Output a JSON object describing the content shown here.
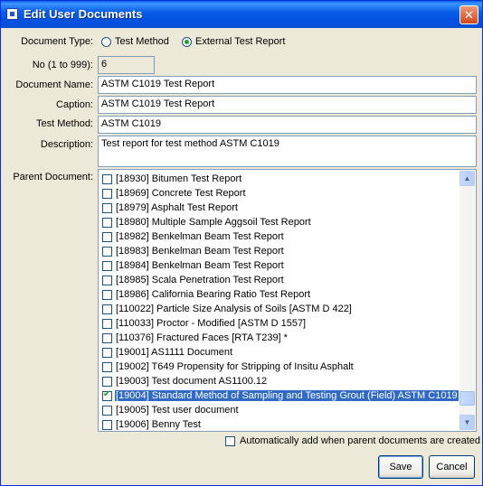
{
  "window": {
    "title": "Edit User Documents"
  },
  "document_type": {
    "label": "Document Type:",
    "options": [
      "Test Method",
      "External Test Report"
    ],
    "selected": "External Test Report"
  },
  "number": {
    "label": "No (1 to 999):",
    "value": "6"
  },
  "document_name": {
    "label": "Document Name:",
    "value": "ASTM C1019 Test Report"
  },
  "caption": {
    "label": "Caption:",
    "value": "ASTM C1019 Test Report"
  },
  "test_method": {
    "label": "Test Method:",
    "value": "ASTM C1019"
  },
  "description": {
    "label": "Description:",
    "value": "Test report for test method ASTM C1019"
  },
  "parent_document": {
    "label": "Parent Document:",
    "items": [
      {
        "text": "[18930] Bitumen Test Report",
        "checked": false
      },
      {
        "text": "[18969] Concrete Test Report",
        "checked": false
      },
      {
        "text": "[18979] Asphalt Test Report",
        "checked": false
      },
      {
        "text": "[18980] Multiple Sample Aggsoil Test Report",
        "checked": false
      },
      {
        "text": "[18982] Benkelman Beam Test Report",
        "checked": false
      },
      {
        "text": "[18983] Benkelman Beam Test Report",
        "checked": false
      },
      {
        "text": "[18984] Benkelman Beam Test Report",
        "checked": false
      },
      {
        "text": "[18985] Scala Penetration Test Report",
        "checked": false
      },
      {
        "text": "[18986] California Bearing Ratio Test Report",
        "checked": false
      },
      {
        "text": "[110022] Particle Size Analysis of Soils [ASTM D 422]",
        "checked": false
      },
      {
        "text": "[110033] Proctor - Modified [ASTM D 1557]",
        "checked": false
      },
      {
        "text": "[110376] Fractured Faces [RTA T239] *",
        "checked": false
      },
      {
        "text": "[19001] AS1111 Document",
        "checked": false
      },
      {
        "text": "[19002] T649 Propensity for Stripping of Insitu Asphalt",
        "checked": false
      },
      {
        "text": "[19003] Test document AS1100.12",
        "checked": false
      },
      {
        "text": "[19004] Standard Method of Sampling and Testing Grout (Field) ASTM C1019",
        "checked": true,
        "selected": true
      },
      {
        "text": "[19005] Test user document",
        "checked": false
      },
      {
        "text": "[19006] Benny Test",
        "checked": false
      }
    ]
  },
  "auto_add": {
    "label": "Automatically add when parent documents are created",
    "checked": false
  },
  "buttons": {
    "save": "Save",
    "cancel": "Cancel"
  },
  "icons": {
    "window": "app-icon",
    "close": "close-icon",
    "scroll_up": "scroll-up-arrow-icon",
    "scroll_down": "scroll-down-arrow-icon"
  }
}
